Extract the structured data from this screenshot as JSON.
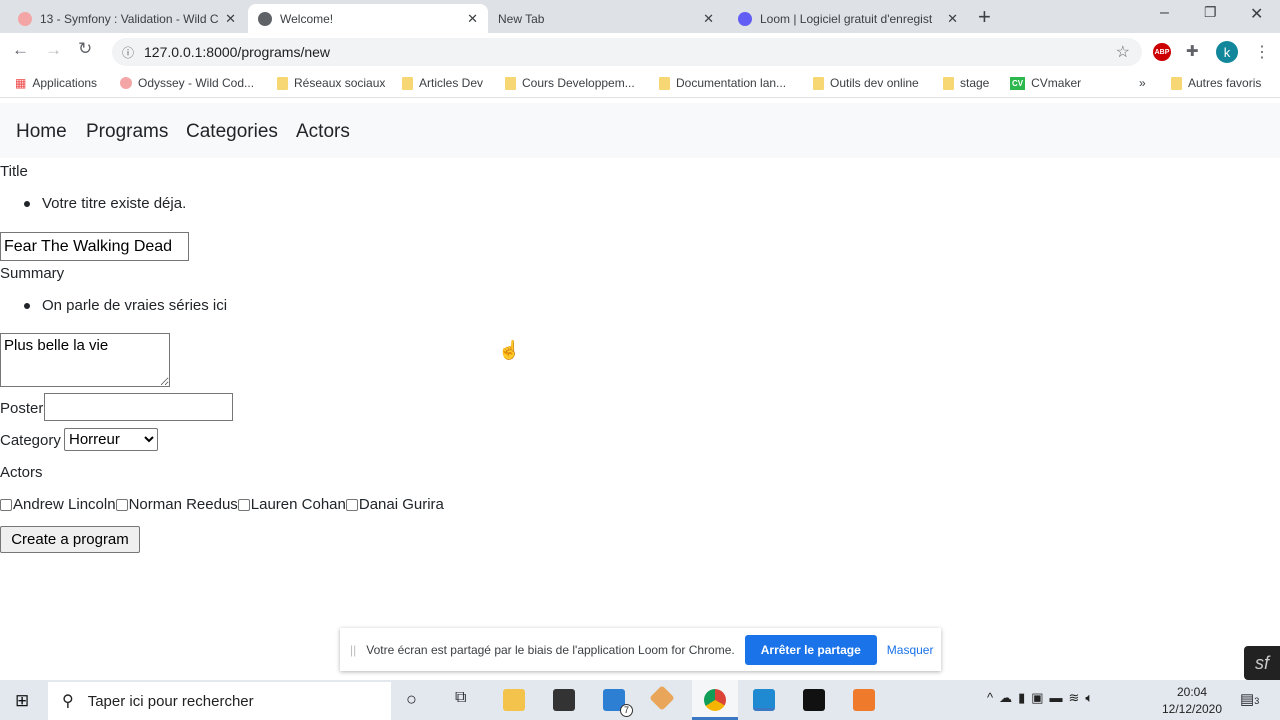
{
  "browser": {
    "tabs": [
      {
        "title": "13 - Symfony : Validation - Wild C"
      },
      {
        "title": "Welcome!"
      },
      {
        "title": "New Tab"
      },
      {
        "title": "Loom | Logiciel gratuit d'enregist"
      }
    ],
    "url": "127.0.0.1:8000/programs/new",
    "bookmarks": [
      "Applications",
      "Odyssey - Wild Cod...",
      "Réseaux sociaux",
      "Articles Dev",
      "Cours Developpem...",
      "Documentation lan...",
      "Outils dev online",
      "stage",
      "CVmaker",
      "Autres favoris"
    ],
    "profile_initial": "k",
    "abp": "ABP",
    "cv": "CV",
    "more": "»"
  },
  "nav": [
    "Home",
    "Programs",
    "Categories",
    "Actors"
  ],
  "form": {
    "title_label": "Title",
    "title_error": "Votre titre existe déja.",
    "title_value": "Fear The Walking Dead",
    "summary_label": "Summary",
    "summary_error": "On parle de vraies séries ici",
    "summary_value": "Plus belle la vie",
    "poster_label": "Poster",
    "poster_value": "",
    "category_label": "Category",
    "category_value": "Horreur",
    "actors_label": "Actors",
    "actors": [
      "Andrew Lincoln",
      "Norman Reedus",
      "Lauren Cohan",
      "Danai Gurira"
    ],
    "submit": "Create a program"
  },
  "loom": {
    "message": "Votre écran est partagé par le biais de l'application Loom for Chrome.",
    "stop": "Arrêter le partage",
    "hide": "Masquer"
  },
  "taskbar": {
    "search_placeholder": "Taper ici pour rechercher",
    "time": "20:04",
    "date": "12/12/2020",
    "mail_badge": "7",
    "notif_badge": "3"
  }
}
